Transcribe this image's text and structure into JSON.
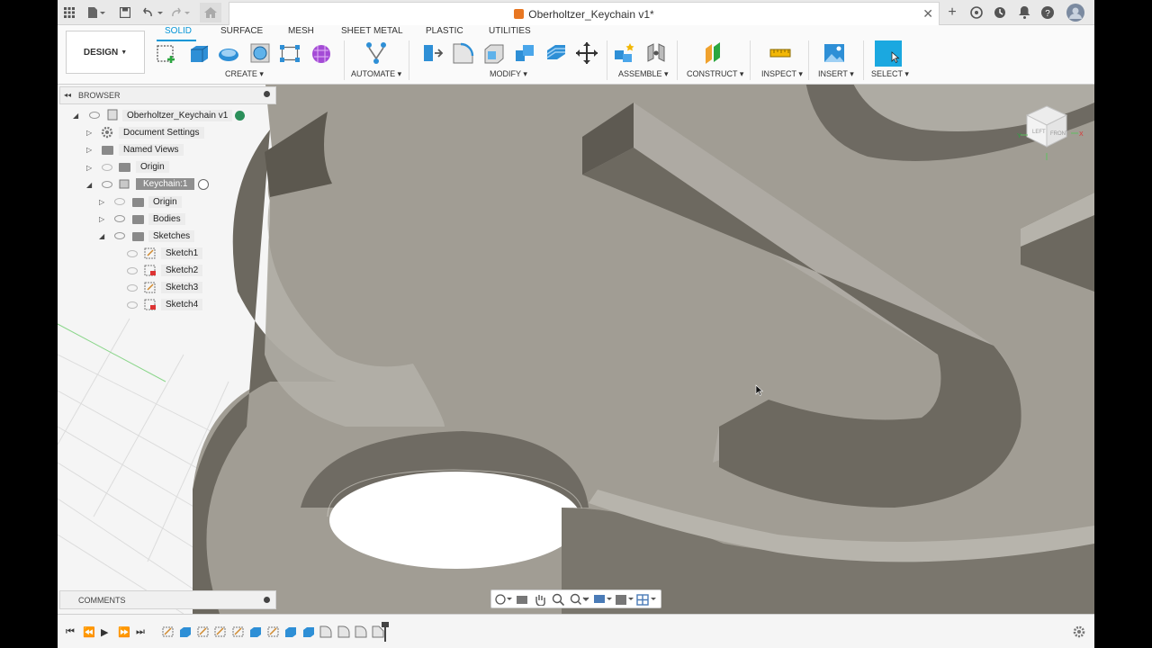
{
  "document": {
    "title": "Oberholtzer_Keychain v1*"
  },
  "workspace": {
    "label": "DESIGN"
  },
  "ribbon": {
    "tabs": [
      "SOLID",
      "SURFACE",
      "MESH",
      "SHEET METAL",
      "PLASTIC",
      "UTILITIES"
    ],
    "active_tab": "SOLID",
    "groups": [
      "CREATE",
      "AUTOMATE",
      "MODIFY",
      "ASSEMBLE",
      "CONSTRUCT",
      "INSPECT",
      "INSERT",
      "SELECT"
    ]
  },
  "browser": {
    "title": "BROWSER",
    "root": "Oberholtzer_Keychain v1",
    "items": {
      "document_settings": "Document Settings",
      "named_views": "Named Views",
      "origin_root": "Origin",
      "component": "Keychain:1",
      "origin": "Origin",
      "bodies": "Bodies",
      "sketches": "Sketches",
      "sketch1": "Sketch1",
      "sketch2": "Sketch2",
      "sketch3": "Sketch3",
      "sketch4": "Sketch4"
    }
  },
  "comments": {
    "title": "COMMENTS"
  },
  "viewcube": {
    "left": "LEFT",
    "front": "FRONT"
  },
  "colors": {
    "accent": "#0696d7",
    "model_top": "#9e9a90",
    "model_side": "#6e6a62"
  }
}
